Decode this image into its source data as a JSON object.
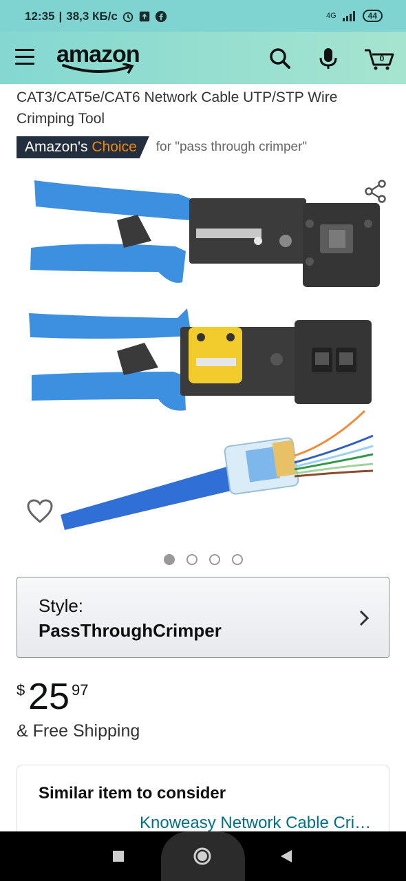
{
  "status_bar": {
    "time": "12:35",
    "speed": "38,3 КБ/с",
    "network": "4G",
    "battery": "44"
  },
  "header": {
    "logo_text": "amazon",
    "icons": [
      "menu-icon",
      "search-icon",
      "microphone-icon",
      "cart-icon"
    ]
  },
  "product": {
    "title": "CAT3/CAT5e/CAT6 Network Cable UTP/STP Wire Crimping Tool",
    "badge": {
      "prefix": "Amazon's",
      "highlight": "Choice",
      "query": "for \"pass through crimper\""
    },
    "image_count": 4,
    "active_image": 1
  },
  "style_selector": {
    "label": "Style:",
    "value": "PassThroughCrimper"
  },
  "price": {
    "symbol": "$",
    "whole": "25",
    "fraction": "97",
    "shipping": "& Free Shipping"
  },
  "similar": {
    "title": "Similar item to consider",
    "link": "Knoweasy Network Cable Crimper"
  },
  "colors": {
    "header_start": "#84d8d1",
    "header_end": "#a6e4cf",
    "badge_bg": "#232f3e",
    "badge_accent": "#f08804",
    "link": "#007185",
    "handle_blue": "#3d8fe0"
  }
}
